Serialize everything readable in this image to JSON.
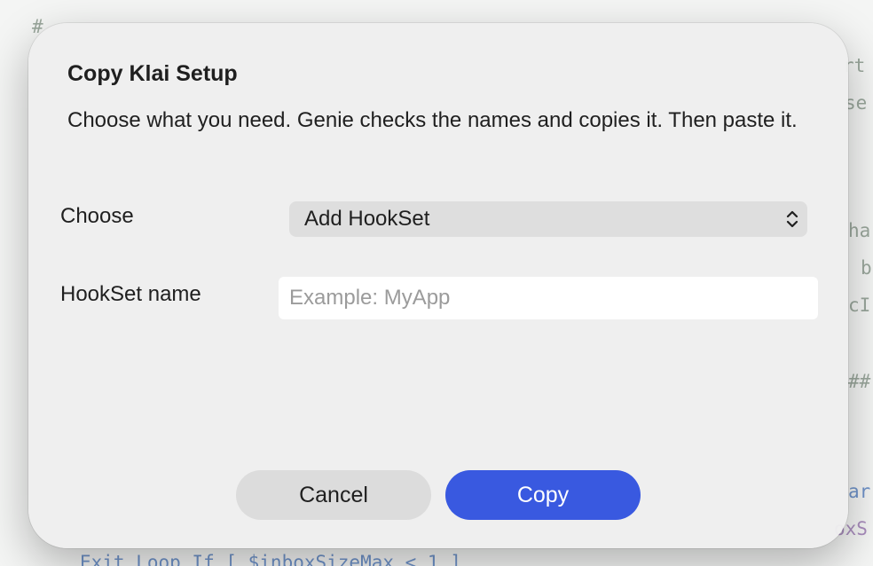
{
  "editor": {
    "lines": [
      {
        "text": "#",
        "style": "green"
      },
      {
        "text": "rt",
        "style": "green"
      },
      {
        "text": "se",
        "style": "green"
      },
      {
        "text": "ha",
        "style": "green"
      },
      {
        "text": "b",
        "style": "green"
      },
      {
        "text": "cI",
        "style": "green"
      },
      {
        "text": "##",
        "style": "green"
      },
      {
        "text": "ar",
        "style": "blue"
      },
      {
        "text": "oxS",
        "style": "purple"
      },
      {
        "text": "Exit Loop If [ $inboxSizeMax < 1 ]",
        "style": "blue"
      }
    ]
  },
  "dialog": {
    "title": "Copy Klai Setup",
    "description": "Choose what you need. Genie checks the names and copies it. Then paste it.",
    "choose_label": "Choose",
    "choose_value": "Add HookSet",
    "name_label": "HookSet name",
    "name_value": "",
    "name_placeholder": "Example: MyApp",
    "cancel_label": "Cancel",
    "copy_label": "Copy"
  },
  "colors": {
    "accent": "#3959e0",
    "sheet_background": "#eeeeee"
  },
  "icons": {
    "select_indicator": "chevron-up-down-icon"
  }
}
